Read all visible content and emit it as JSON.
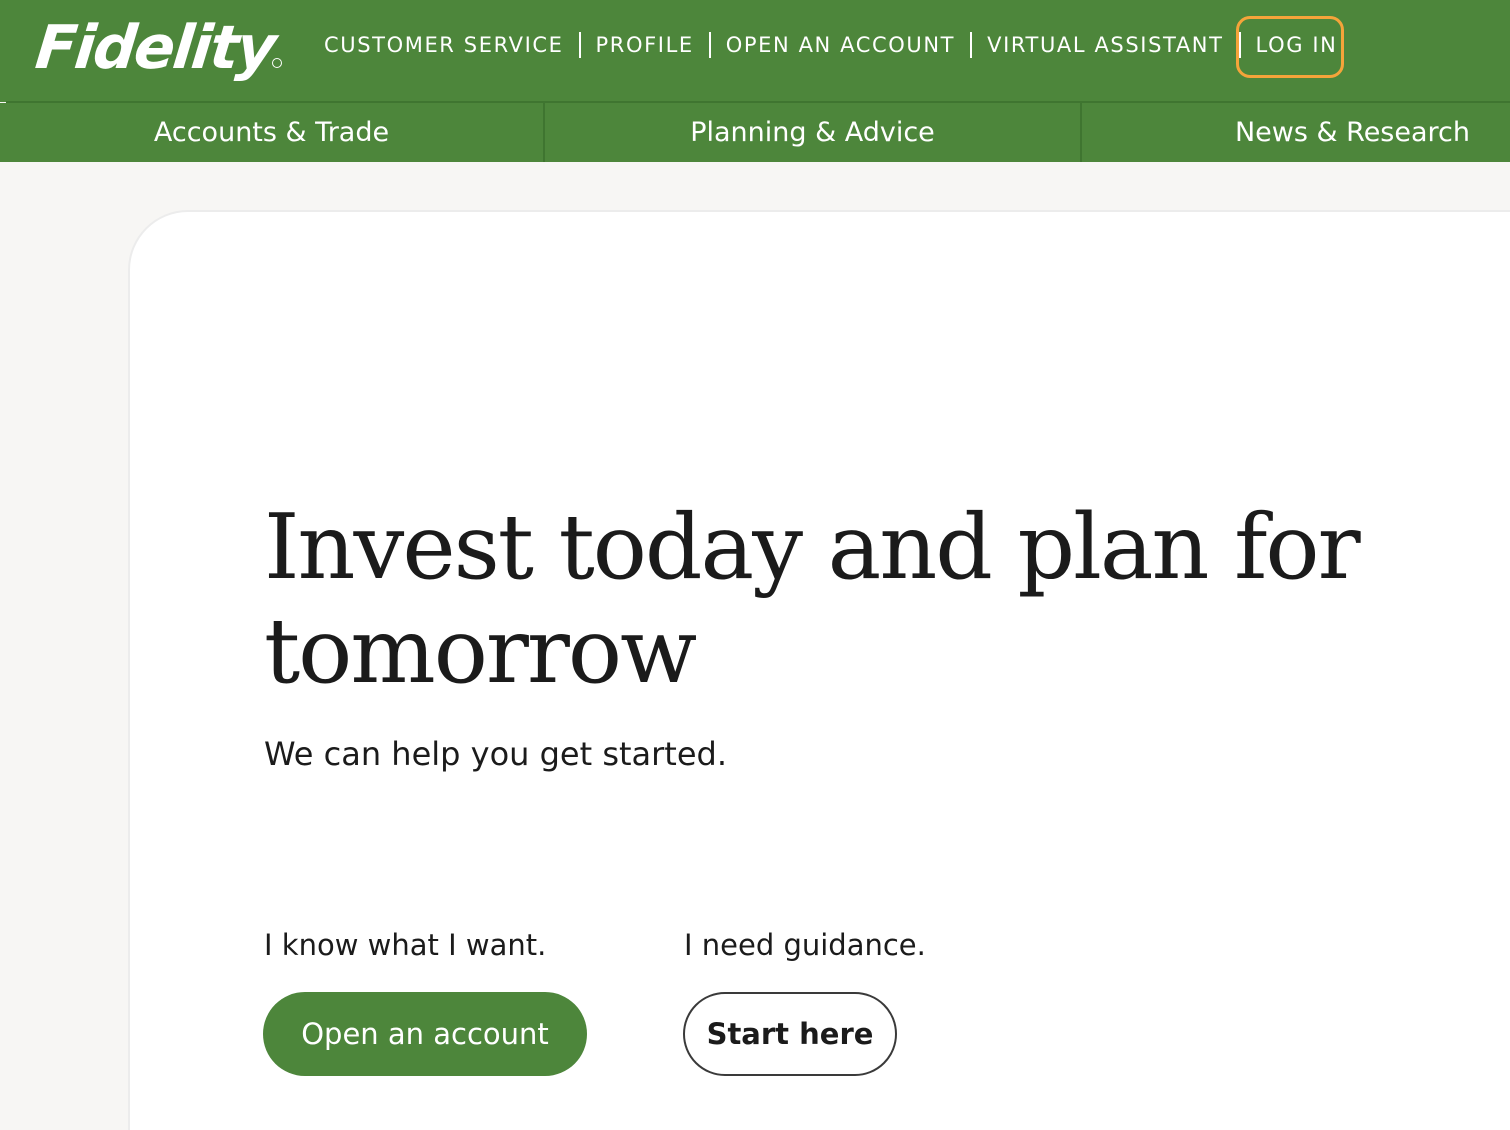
{
  "brand": {
    "logo_text": "Fidelity",
    "primary_color": "#4d863b",
    "focus_color": "#f5a43a"
  },
  "utility_nav": {
    "items": [
      {
        "label": "CUSTOMER SERVICE"
      },
      {
        "label": "PROFILE"
      },
      {
        "label": "OPEN AN ACCOUNT"
      },
      {
        "label": "VIRTUAL ASSISTANT"
      },
      {
        "label": "LOG IN"
      }
    ]
  },
  "main_nav": {
    "items": [
      {
        "label": "Accounts & Trade"
      },
      {
        "label": "Planning & Advice"
      },
      {
        "label": "News & Research"
      }
    ]
  },
  "hero": {
    "title": "Invest today and plan for tomorrow",
    "subtitle": "We can help you get started."
  },
  "cta": {
    "left": {
      "prompt": "I know what I want.",
      "button_label": "Open an account"
    },
    "right": {
      "prompt": "I need guidance.",
      "button_label": "Start here"
    }
  }
}
